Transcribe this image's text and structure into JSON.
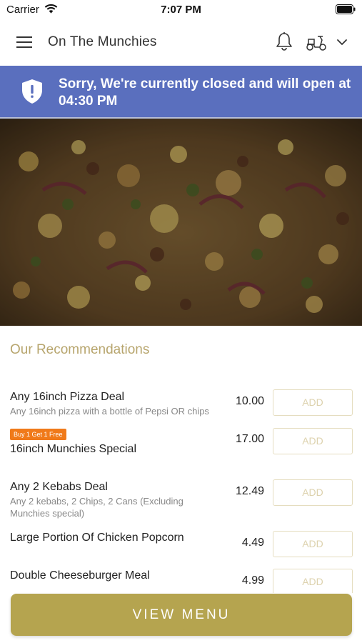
{
  "status_bar": {
    "carrier": "Carrier",
    "time": "7:07 PM"
  },
  "header": {
    "title": "On The Munchies",
    "icons": [
      "menu-icon",
      "bell-icon",
      "scooter-icon",
      "chevron-down-icon"
    ]
  },
  "banner": {
    "message": "Sorry, We're currently closed and will open at 04:30 PM",
    "color": "#5a6fbe",
    "icon": "shield-icon"
  },
  "recommendations": {
    "title": "Our Recommendations",
    "items": [
      {
        "name": "Any 16inch Pizza Deal",
        "description": "Any 16inch pizza with a bottle of Pepsi OR chips",
        "price": "10.00",
        "add_label": "ADD"
      },
      {
        "badge": "Buy 1 Get 1 Free",
        "name": "16inch Munchies Special",
        "price": "17.00",
        "add_label": "ADD"
      },
      {
        "name": "Any 2 Kebabs Deal",
        "description": "Any 2 kebabs, 2 Chips, 2 Cans (Excluding Munchies special)",
        "price": "12.49",
        "add_label": "ADD"
      },
      {
        "name": "Large Portion Of Chicken Popcorn",
        "price": "4.49",
        "add_label": "ADD"
      },
      {
        "name": "Double Cheeseburger Meal",
        "price": "4.99",
        "add_label": "ADD"
      }
    ]
  },
  "footer": {
    "view_menu_label": "VIEW MENU",
    "color": "#b5a44f"
  },
  "colors": {
    "accent": "#b7a56d",
    "badge": "#f07a1a"
  }
}
